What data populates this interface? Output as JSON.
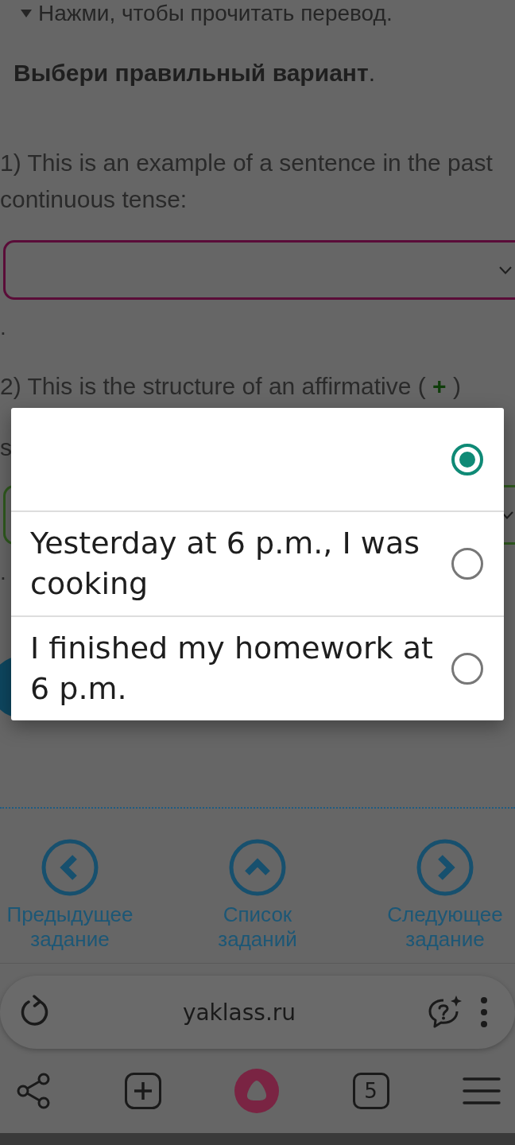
{
  "translation_hint": {
    "text": "Нажми, чтобы прочитать перевод."
  },
  "instruction": "**Выбери правильный вариант**.",
  "questions": [
    {
      "text": "1) This is an example of a sentence in the past continuous tense:",
      "select": {
        "color": "#5a0c38"
      },
      "mark": "."
    },
    {
      "text": "2) This is the structure of an affirmative ( ",
      "sign": "+",
      "text_end": " )",
      "continuation": "s",
      "select": {
        "color": "#2f5a1e"
      },
      "mark": "."
    }
  ],
  "dialog": {
    "options": [
      {
        "selected": true
      },
      {
        "text": "Yesterday at 6 p.m., I was cooking",
        "selected": false
      },
      {
        "text": "I finished my homework at 6 p.m.",
        "selected": false
      }
    ]
  },
  "task_nav": [
    {
      "kind": "previous",
      "label": "Предыдущее задание"
    },
    {
      "kind": "list",
      "label": "Список заданий"
    },
    {
      "kind": "next",
      "label": "Следующее задание"
    }
  ],
  "browser": {
    "url": "yaklass.ru",
    "tab_count": "5"
  }
}
